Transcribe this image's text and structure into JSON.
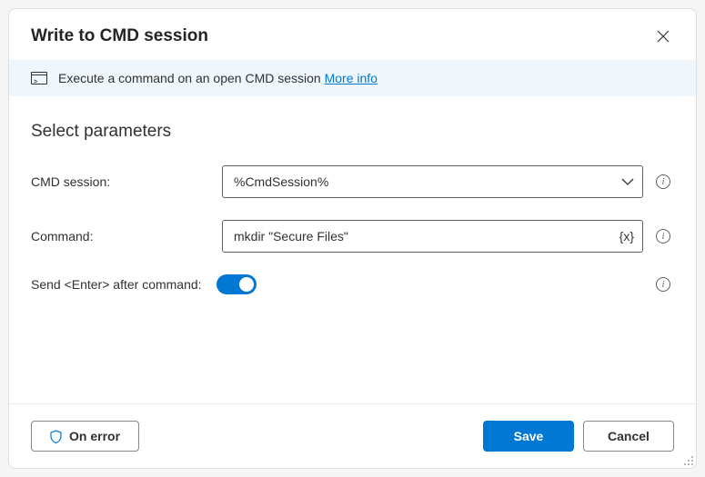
{
  "header": {
    "title": "Write to CMD session"
  },
  "infoBar": {
    "text": "Execute a command on an open CMD session ",
    "moreInfo": "More info"
  },
  "section": {
    "title": "Select parameters"
  },
  "fields": {
    "cmdSession": {
      "label": "CMD session:",
      "value": "%CmdSession%"
    },
    "command": {
      "label": "Command:",
      "value": "mkdir \"Secure Files\""
    },
    "sendEnter": {
      "label": "Send <Enter> after command:",
      "value": true
    }
  },
  "footer": {
    "onError": "On error",
    "save": "Save",
    "cancel": "Cancel"
  }
}
